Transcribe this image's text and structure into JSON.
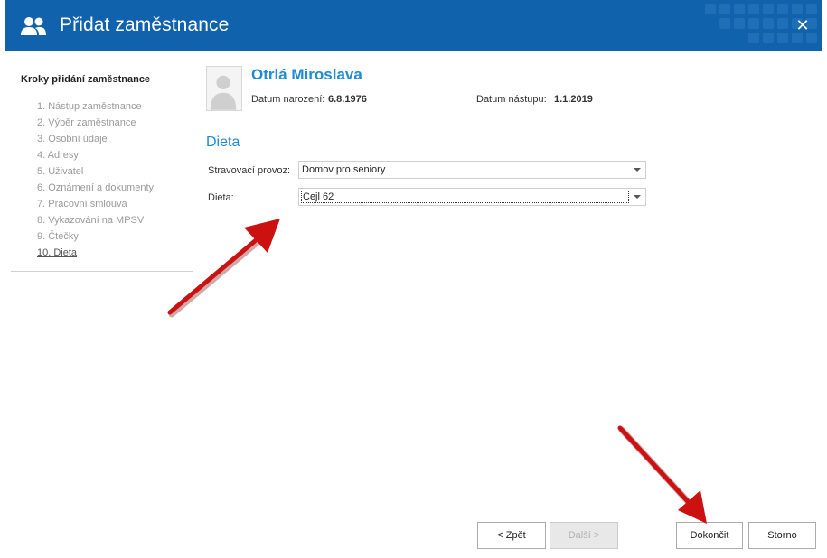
{
  "window": {
    "title": "Přidat zaměstnance",
    "close_label": "✕",
    "title_bar_color": "#1162ad"
  },
  "steps": {
    "heading": "Kroky přidání zaměstnance",
    "items": [
      "1. Nástup zaměstnance",
      "2. Výběr zaměstnance",
      "3. Osobní údaje",
      "4. Adresy",
      "5. Uživatel",
      "6. Oznámení a dokumenty",
      "7. Pracovní smlouva",
      "8. Vykazování na MPSV",
      "9. Čtečky",
      "10. Dieta"
    ],
    "current_index": 9
  },
  "employee": {
    "name": "Otrlá Miroslava",
    "birth_label": "Datum narození:",
    "birth_value": "6.8.1976",
    "start_label": "Datum nástupu:",
    "start_value": "1.1.2019"
  },
  "section": {
    "title": "Dieta"
  },
  "form": {
    "provider_label": "Stravovací provoz:",
    "provider_value": "Domov pro seniory",
    "diet_label": "Dieta:",
    "diet_value": "Cejl 62"
  },
  "buttons": {
    "back": "< Zpět",
    "next": "Další >",
    "finish": "Dokončit",
    "cancel": "Storno"
  },
  "colors": {
    "accent": "#1e8bd2",
    "annotation_arrow": "#cc1111"
  }
}
